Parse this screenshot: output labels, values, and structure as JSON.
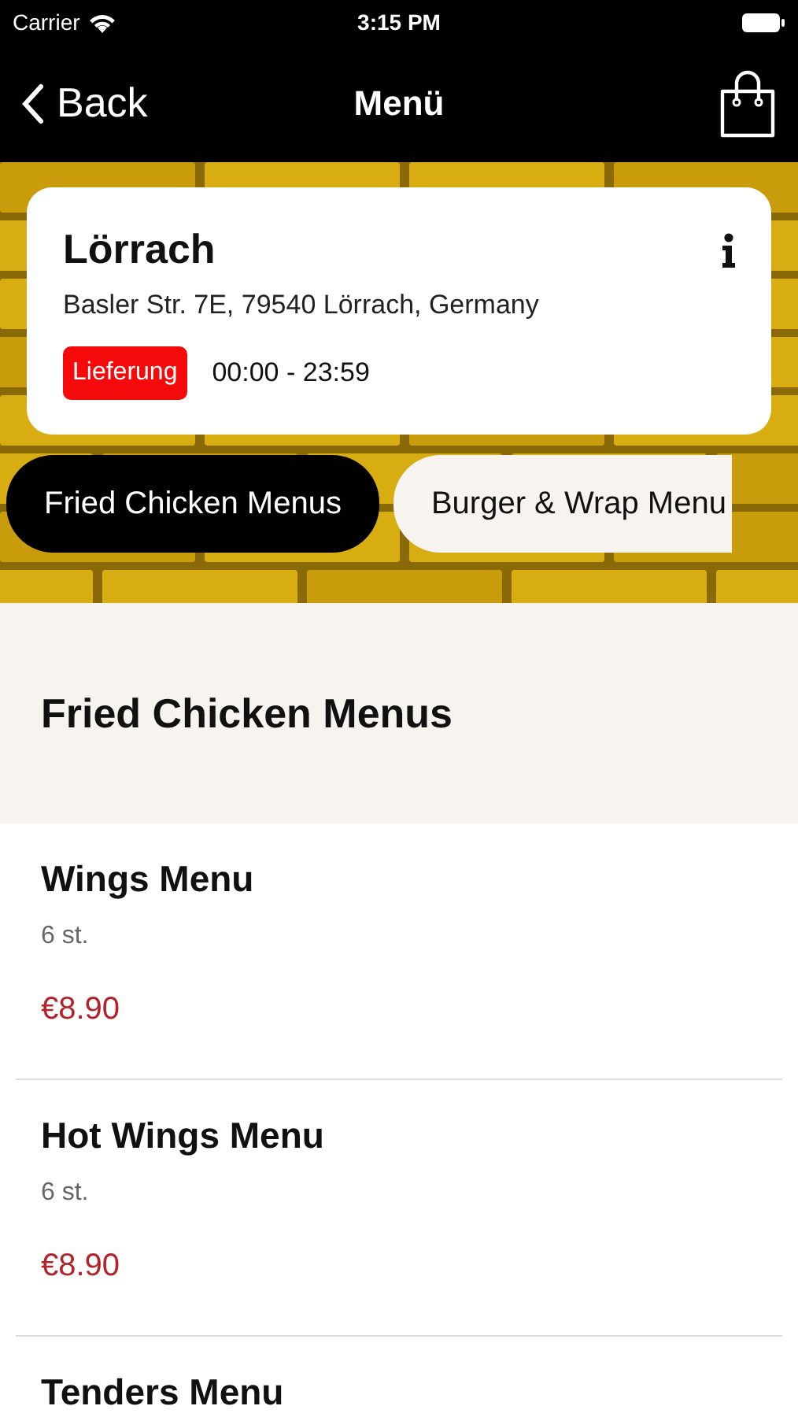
{
  "status_bar": {
    "carrier": "Carrier",
    "time": "3:15 PM"
  },
  "nav": {
    "back": "Back",
    "title": "Menü"
  },
  "store": {
    "name": "Lörrach",
    "address": "Basler Str. 7E, 79540 Lörrach, Germany",
    "badge": "Lieferung",
    "hours": "00:00 - 23:59"
  },
  "tabs": [
    {
      "label": "Fried Chicken Menus",
      "selected": true
    },
    {
      "label": "Burger & Wrap Menu",
      "selected": false
    }
  ],
  "section": {
    "title": "Fried Chicken Menus"
  },
  "items": [
    {
      "name": "Wings Menu",
      "note": "6 st.",
      "price": "€8.90"
    },
    {
      "name": "Hot Wings Menu",
      "note": "6 st.",
      "price": "€8.90"
    },
    {
      "name": "Tenders Menu"
    }
  ]
}
